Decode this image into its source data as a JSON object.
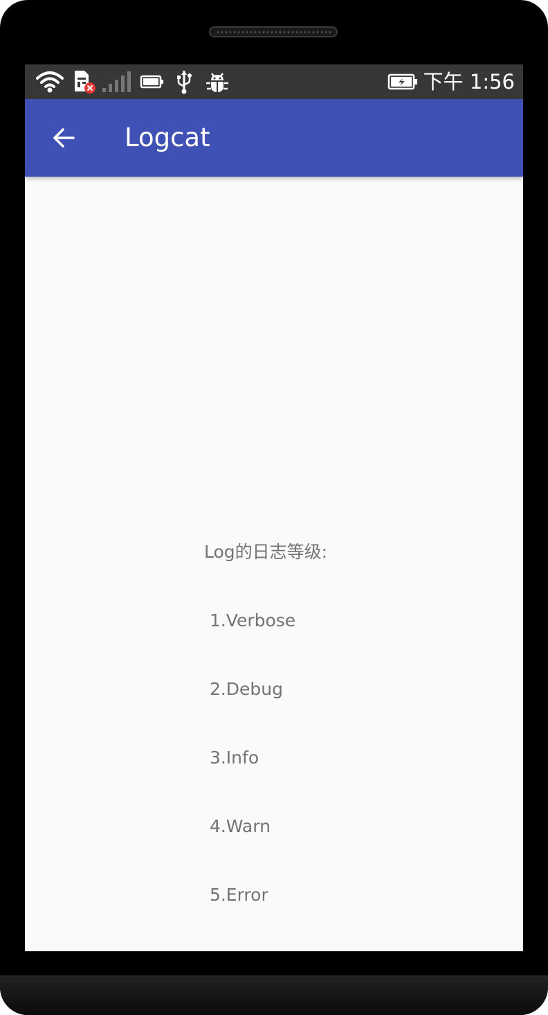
{
  "status_bar": {
    "icons": [
      "wifi-icon",
      "sim-card-error-icon",
      "cell-signal-icon",
      "battery-small-icon",
      "usb-icon",
      "debug-bug-icon",
      "battery-charging-icon"
    ],
    "time": "下午 1:56"
  },
  "app_bar": {
    "back_icon": "arrow-left-icon",
    "title": "Logcat",
    "color": "#3f51b5"
  },
  "content": {
    "lines": [
      "Log的日志等级:",
      " 1.Verbose",
      " 2.Debug",
      " 3.Info",
      " 4.Warn",
      " 5.Error"
    ]
  },
  "colors": {
    "status_bar": "#373737",
    "background": "#fafafa",
    "text": "#737373"
  }
}
